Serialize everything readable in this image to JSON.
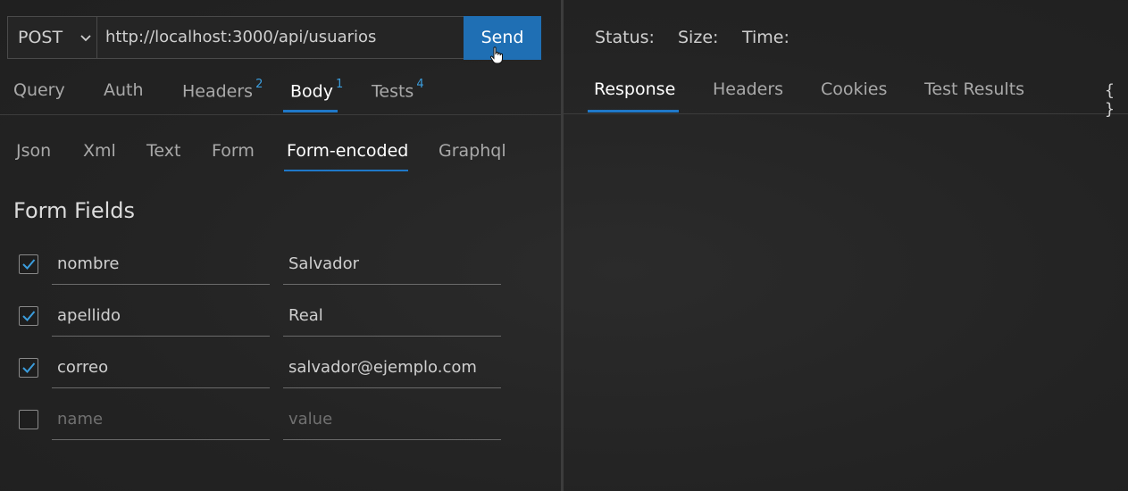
{
  "request": {
    "method": "POST",
    "url": "http://localhost:3000/api/usuarios",
    "send_label": "Send"
  },
  "request_tabs": [
    {
      "label": "Query",
      "badge": ""
    },
    {
      "label": "Auth",
      "badge": ""
    },
    {
      "label": "Headers",
      "badge": "2"
    },
    {
      "label": "Body",
      "badge": "1"
    },
    {
      "label": "Tests",
      "badge": "4"
    }
  ],
  "active_request_tab": "Body",
  "body_tabs": [
    "Json",
    "Xml",
    "Text",
    "Form",
    "Form-encoded",
    "Graphql"
  ],
  "active_body_tab": "Form-encoded",
  "form": {
    "title": "Form Fields",
    "fields": [
      {
        "checked": true,
        "name": "nombre",
        "value": "Salvador"
      },
      {
        "checked": true,
        "name": "apellido",
        "value": "Real"
      },
      {
        "checked": true,
        "name": "correo",
        "value": "salvador@ejemplo.com"
      }
    ],
    "new_field": {
      "checked": false,
      "name_placeholder": "name",
      "value_placeholder": "value"
    }
  },
  "response": {
    "status_label": "Status:",
    "size_label": "Size:",
    "time_label": "Time:",
    "tabs": [
      "Response",
      "Headers",
      "Cookies",
      "Test Results"
    ],
    "active_tab": "Response",
    "braces_label": "{ }"
  },
  "colors": {
    "accent": "#1f78c8",
    "send_button": "#1f6fb4",
    "badge": "#3b9ddd",
    "background": "#232323"
  }
}
